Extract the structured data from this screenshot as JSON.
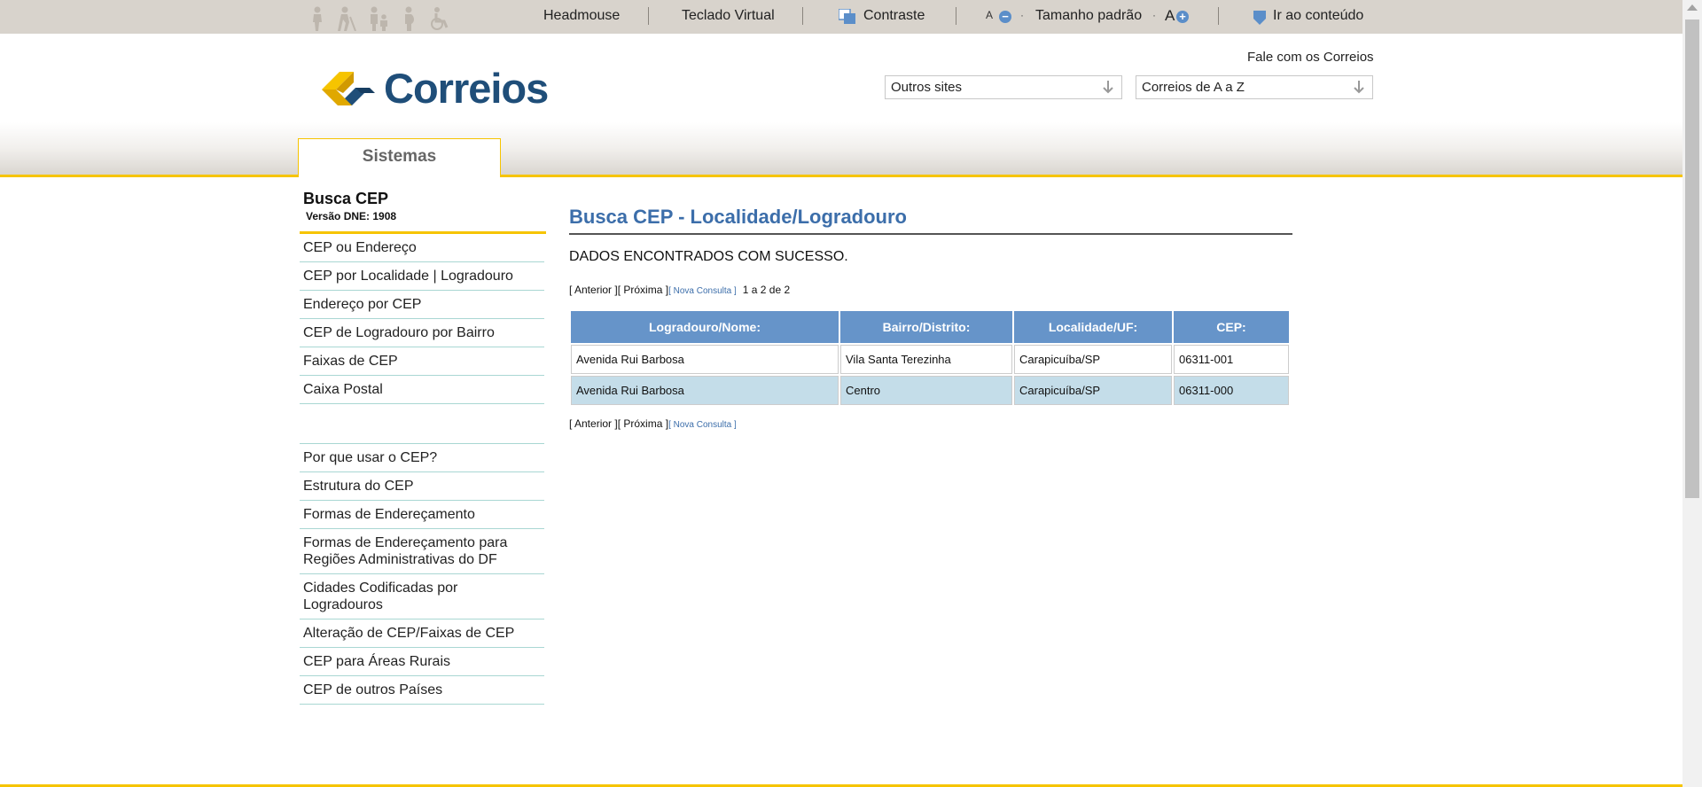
{
  "accessibility": {
    "headmouse": "Headmouse",
    "teclado": "Teclado Virtual",
    "contraste": "Contraste",
    "font_small": "A",
    "tamanho": "Tamanho padrão",
    "font_big": "A",
    "ir_conteudo": "Ir ao conteúdo"
  },
  "header": {
    "logo_text": "Correios",
    "fale": "Fale com os Correios",
    "outros_sites": "Outros sites",
    "correios_az": "Correios de A a Z",
    "tab": "Sistemas"
  },
  "sidebar": {
    "title": "Busca CEP",
    "version": "Versão DNE: 1908",
    "group1": [
      "CEP ou Endereço",
      "CEP por Localidade | Logradouro",
      "Endereço por CEP",
      "CEP de Logradouro por Bairro",
      "Faixas de CEP",
      "Caixa Postal"
    ],
    "group2": [
      "Por que usar o CEP?",
      "Estrutura do CEP",
      "Formas de Endereçamento",
      "Formas de Endereçamento para Regiões Administrativas do DF",
      "Cidades Codificadas por Logradouros",
      "Alteração de CEP/Faixas de CEP",
      "CEP para Áreas Rurais",
      "CEP de outros Países"
    ]
  },
  "main": {
    "title": "Busca CEP - Localidade/Logradouro",
    "status": "DADOS ENCONTRADOS COM SUCESSO.",
    "pager": {
      "anterior": "[ Anterior ]",
      "proxima": "[ Próxima ]",
      "nova": "[ Nova Consulta ]",
      "count": "1 a 2 de 2"
    },
    "columns": [
      "Logradouro/Nome:",
      "Bairro/Distrito:",
      "Localidade/UF:",
      "CEP:"
    ],
    "rows": [
      [
        "Avenida Rui Barbosa",
        "Vila Santa Terezinha",
        "Carapicuíba/SP",
        "06311-001"
      ],
      [
        "Avenida Rui Barbosa",
        "Centro",
        "Carapicuíba/SP",
        "06311-000"
      ]
    ]
  },
  "colors": {
    "accent_yellow": "#f6c400",
    "title_blue": "#3c6eaa",
    "table_header": "#6694c9",
    "row_alt": "#c4dde9"
  }
}
